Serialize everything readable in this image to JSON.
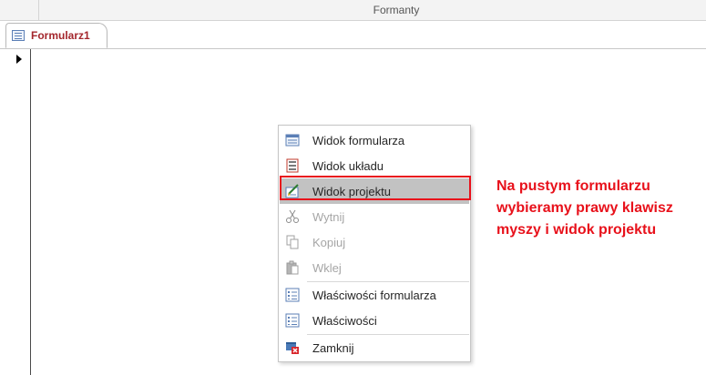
{
  "ribbon": {
    "group_label": "Formanty"
  },
  "document_tab": {
    "title": "Formularz1",
    "icon": "form-icon"
  },
  "context_menu": {
    "items": [
      {
        "label": "Widok formularza",
        "icon": "form-view-icon",
        "state": "enabled"
      },
      {
        "label": "Widok układu",
        "icon": "layout-view-icon",
        "state": "enabled"
      },
      {
        "label": "Widok projektu",
        "icon": "design-view-icon",
        "state": "highlighted"
      },
      {
        "label": "Wytnij",
        "icon": "scissors-icon",
        "state": "disabled"
      },
      {
        "label": "Kopiuj",
        "icon": "copy-icon",
        "state": "disabled"
      },
      {
        "label": "Wklej",
        "icon": "paste-icon",
        "state": "disabled"
      },
      {
        "label": "Właściwości formularza",
        "icon": "form-properties-icon",
        "state": "enabled"
      },
      {
        "label": "Właściwości",
        "icon": "properties-icon",
        "state": "enabled"
      },
      {
        "label": "Zamknij",
        "icon": "close-form-icon",
        "state": "enabled"
      }
    ]
  },
  "annotation": {
    "text": "Na pustym formularzu wybieramy prawy klawisz myszy i widok projektu"
  },
  "colors": {
    "annotation_red": "#e8111b",
    "tab_title_red": "#a4262c",
    "menu_highlight": "#c2c2c2",
    "icon_blue": "#5b7fb6"
  }
}
